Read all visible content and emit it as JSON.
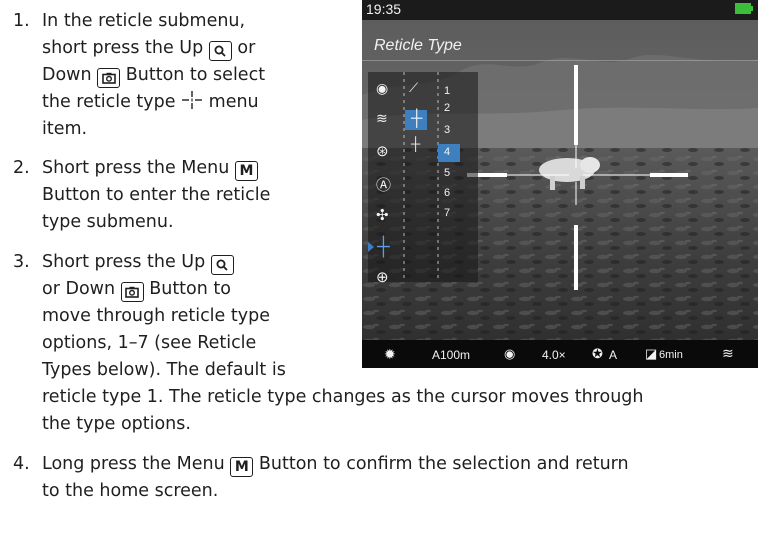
{
  "steps": [
    {
      "number": "1.",
      "lines": [
        "In the reticle submenu,",
        "short press the Up",
        "Down",
        "Button to select",
        "the reticle type",
        "menu",
        "item."
      ]
    },
    {
      "number": "2.",
      "lines": [
        "Short press the Menu",
        "Button to enter the reticle",
        "type submenu."
      ]
    },
    {
      "number": "3.",
      "lines": [
        "Short press the Up",
        "or Down",
        "Button to",
        "move through reticle type",
        "options, 1–7 (see Reticle",
        "Types below). The default is",
        "reticle type 1. The reticle type changes as the cursor moves through",
        "the type options."
      ]
    },
    {
      "number": "4.",
      "lines": [
        "Long press the Menu",
        "Button to confirm the selection and return",
        "to the home screen."
      ]
    }
  ],
  "words": {
    "or": "or"
  },
  "keys": {
    "menu": "M"
  },
  "device": {
    "time": "19:35",
    "menu_title": "Reticle Type",
    "type_numbers": [
      "1",
      "2",
      "3",
      "4",
      "5",
      "6",
      "7"
    ],
    "selected_index": 3,
    "status": {
      "range": "A100m",
      "zoom": "4.0×",
      "mode": "A",
      "timer": "6min"
    }
  }
}
